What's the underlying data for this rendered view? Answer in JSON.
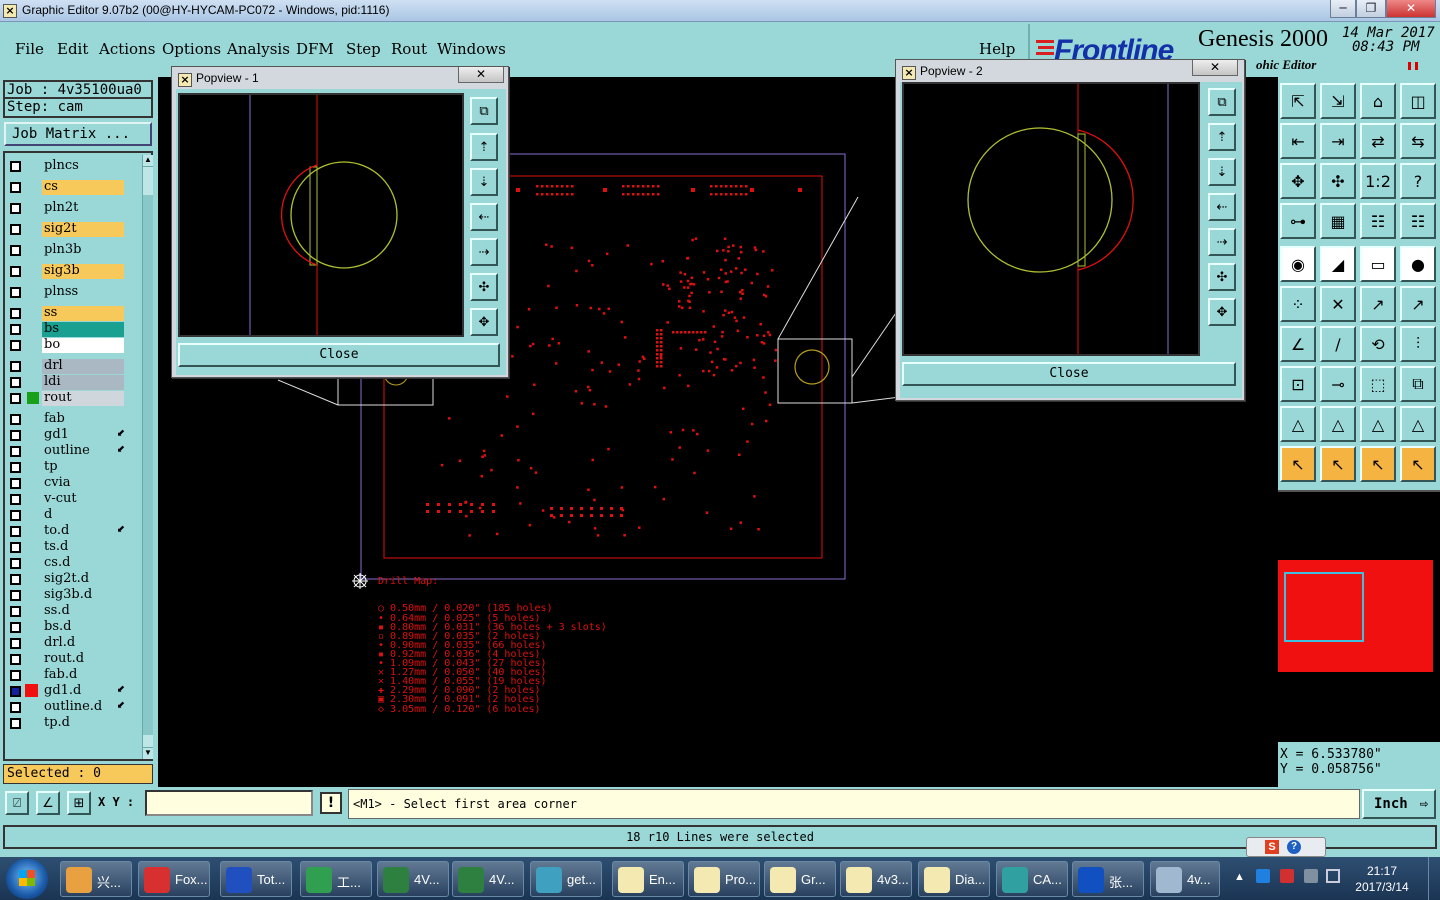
{
  "window": {
    "title": "Graphic Editor 9.07b2 (00@HY-HYCAM-PC072 - Windows, pid:1116)",
    "min": "─",
    "max": "❐",
    "close": "✕"
  },
  "menu": {
    "items": [
      "File",
      "Edit",
      "Actions",
      "Options",
      "Analysis",
      "DFM",
      "Step",
      "Rout",
      "Windows"
    ],
    "help": "Help"
  },
  "brand": {
    "frontline": "Frontline",
    "genesis": "Genesis 2000",
    "date": "14 Mar 2017",
    "time": "08:43 PM",
    "editor_partial": "ohic Editor"
  },
  "job": {
    "job_line": "Job : 4v35100ua0",
    "step_line": "Step: cam",
    "matrix_button": "Job Matrix ..."
  },
  "layers": [
    {
      "name": "plncs",
      "color": "#9ad8d8"
    },
    {
      "name": "cs",
      "color": "#f7c95a"
    },
    {
      "name": "pln2t",
      "color": "#9ad8d8"
    },
    {
      "name": "sig2t",
      "color": "#f7c95a"
    },
    {
      "name": "pln3b",
      "color": "#9ad8d8"
    },
    {
      "name": "sig3b",
      "color": "#f7c95a"
    },
    {
      "name": "plnss",
      "color": "#9ad8d8"
    },
    {
      "name": "ss",
      "color": "#f7c95a"
    },
    {
      "name": "bs",
      "color": "#1aa090"
    },
    {
      "name": "bo",
      "color": "#ffffff"
    },
    {
      "name": "drl",
      "color": "#aab8c4"
    },
    {
      "name": "ldi",
      "color": "#aab8c4"
    },
    {
      "name": "rout",
      "color": "#cfd6dc"
    },
    {
      "name": "fab",
      "color": "#9ad8d8"
    },
    {
      "name": "gd1",
      "color": "#9ad8d8"
    },
    {
      "name": "outline",
      "color": "#9ad8d8"
    },
    {
      "name": "tp",
      "color": "#9ad8d8"
    },
    {
      "name": "cvia",
      "color": "#9ad8d8"
    },
    {
      "name": "v-cut",
      "color": "#9ad8d8"
    },
    {
      "name": "d",
      "color": "#9ad8d8"
    },
    {
      "name": "to.d",
      "color": "#9ad8d8"
    },
    {
      "name": "ts.d",
      "color": "#9ad8d8"
    },
    {
      "name": "cs.d",
      "color": "#9ad8d8"
    },
    {
      "name": "sig2t.d",
      "color": "#9ad8d8"
    },
    {
      "name": "sig3b.d",
      "color": "#9ad8d8"
    },
    {
      "name": "ss.d",
      "color": "#9ad8d8"
    },
    {
      "name": "bs.d",
      "color": "#9ad8d8"
    },
    {
      "name": "drl.d",
      "color": "#9ad8d8"
    },
    {
      "name": "rout.d",
      "color": "#9ad8d8"
    },
    {
      "name": "fab.d",
      "color": "#9ad8d8"
    },
    {
      "name": "gd1.d",
      "color": "#9ad8d8"
    },
    {
      "name": "outline.d",
      "color": "#9ad8d8"
    },
    {
      "name": "tp.d",
      "color": "#9ad8d8"
    }
  ],
  "selected_text": "Selected : 0",
  "popview1": {
    "title": "Popview - 1",
    "close_label": "Close",
    "x": "✕"
  },
  "popview2": {
    "title": "Popview - 2",
    "close_label": "Close",
    "x": "✕"
  },
  "drill_map": {
    "title": "Drill Map:",
    "entries": [
      "0.50mm / 0.020\" (185 holes)",
      "0.64mm / 0.025\" (5 holes)",
      "0.80mm / 0.031\" (36 holes + 3 slots)",
      "0.89mm / 0.035\" (2 holes)",
      "0.90mm / 0.035\" (66 holes)",
      "0.92mm / 0.036\" (4 holes)",
      "1.09mm / 0.043\" (27 holes)",
      "1.27mm / 0.050\" (40 holes)",
      "1.40mm / 0.055\" (19 holes)",
      "2.29mm / 0.090\" (2 holes)",
      "2.30mm / 0.091\" (2 holes)",
      "3.05mm / 0.120\" (6 holes)"
    ]
  },
  "tool_buttons": [
    "⇱",
    "⇲",
    "⌂",
    "◫",
    "⇤",
    "⇥",
    "⇄",
    "⇆",
    "✥",
    "✣",
    "1:2",
    "?",
    "⊶",
    "▦",
    "☷",
    "☷",
    "◉",
    "◢",
    "▭",
    "●",
    "⁘",
    "✕",
    "↗",
    "↗",
    "∠",
    "∕",
    "⟲",
    "⫶",
    "⊡",
    "⊸",
    "⬚",
    "⧉",
    "△",
    "△",
    "△",
    "△",
    "↖",
    "↖",
    "↖",
    "↖"
  ],
  "coords": {
    "x": "X = 6.533780\"",
    "y": "Y = 0.058756\""
  },
  "cmd": {
    "xy_label": "X Y :",
    "xy_value": "",
    "bang": "!",
    "prompt": "<M1> - Select first area corner",
    "unit": "Inch"
  },
  "status_message": "18 r10 Lines were selected",
  "taskbar": {
    "items": [
      {
        "label": "兴...",
        "color": "#e8a040"
      },
      {
        "label": "Fox...",
        "color": "#d83030"
      },
      {
        "label": "Tot...",
        "color": "#2050c0"
      },
      {
        "label": "工...",
        "color": "#30a050"
      },
      {
        "label": "4V...",
        "color": "#2e8040"
      },
      {
        "label": "4V...",
        "color": "#2e8040"
      },
      {
        "label": "get...",
        "color": "#40a0c0"
      },
      {
        "label": "En...",
        "color": "#f4e9b0"
      },
      {
        "label": "Pro...",
        "color": "#f4e9b0"
      },
      {
        "label": "Gr...",
        "color": "#f4e9b0"
      },
      {
        "label": "4v3...",
        "color": "#f4e9b0"
      },
      {
        "label": "Dia...",
        "color": "#f4e9b0"
      },
      {
        "label": "CA...",
        "color": "#30a0a0"
      },
      {
        "label": "张...",
        "color": "#1050c0"
      },
      {
        "label": "4v...",
        "color": "#a0b8d0"
      }
    ],
    "clock_time": "21:17",
    "clock_date": "2017/3/14"
  }
}
